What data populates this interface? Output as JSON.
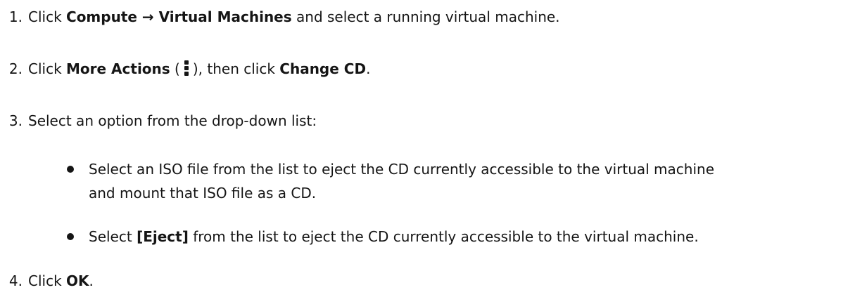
{
  "steps": [
    {
      "number": "1.",
      "t1": "Click ",
      "b1": "Compute → Virtual Machines",
      "t2": " and select a running virtual machine."
    },
    {
      "number": "2.",
      "t1": "Click ",
      "b1": "More Actions",
      "t2": " (",
      "icon": "kebab-vertical-icon",
      "t3": "), then click ",
      "b2": "Change CD",
      "t4": "."
    },
    {
      "number": "3.",
      "t1": "Select an option from the drop-down list:",
      "bullets": [
        {
          "line1": "Select an ISO file from the list to eject the CD currently accessible to the virtual machine",
          "line2": "and mount that ISO file as a CD."
        },
        {
          "t1": "Select ",
          "b1": "[Eject]",
          "t2": " from the list to eject the CD currently accessible to the virtual machine."
        }
      ]
    },
    {
      "number": "4.",
      "t1": "Click ",
      "b1": "OK",
      "t2": "."
    }
  ]
}
